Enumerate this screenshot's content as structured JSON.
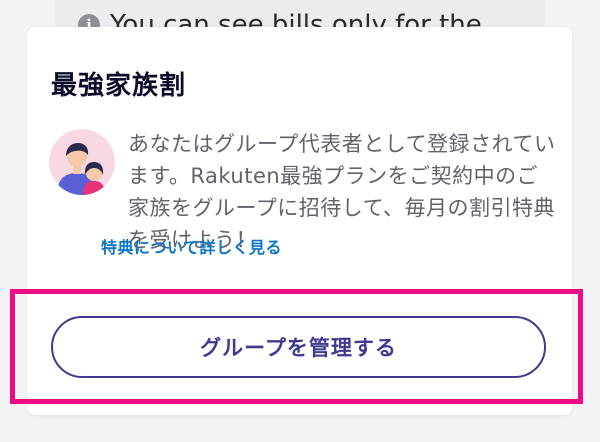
{
  "previous_notice": {
    "text": "You can see bills only for the",
    "icon": "info-icon"
  },
  "family_plan": {
    "title": "最強家族割",
    "description": "あなたはグループ代表者として登録されています。Rakuten最強プランをご契約中のご家族をグループに招待して、毎月の割引特典を受けよう！",
    "link_label": "特典について詳しく見る",
    "button_label": "グループを管理する"
  },
  "colors": {
    "highlight": "#ee0a86",
    "button_accent": "#3e3a8f",
    "link": "#0b73c8"
  }
}
